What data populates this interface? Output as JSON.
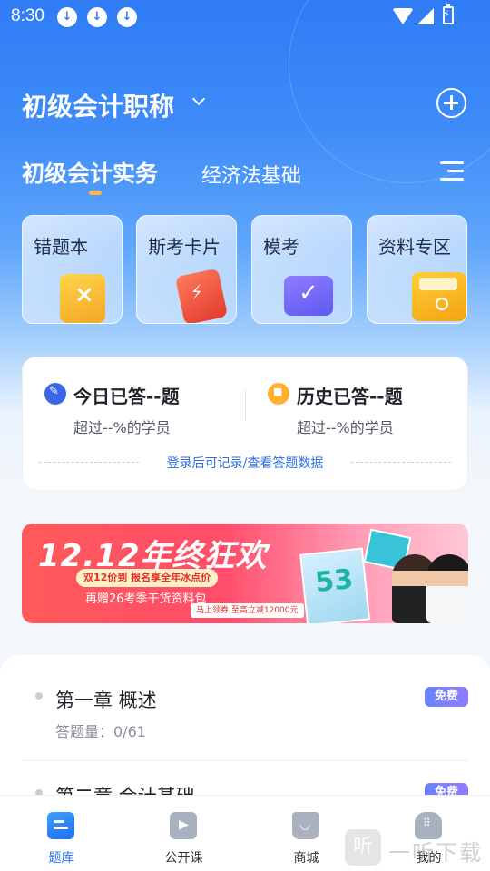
{
  "status_bar": {
    "time": "8:30",
    "download_icons": [
      "download-icon",
      "download-icon",
      "download-icon"
    ]
  },
  "header": {
    "exam_title": "初级会计职称",
    "add_icon": "plus-circle-icon"
  },
  "subject_tabs": [
    {
      "label": "初级会计实务",
      "active": true
    },
    {
      "label": "经济法基础",
      "active": false
    }
  ],
  "tools": [
    {
      "label": "错题本",
      "icon": "wrong-book-icon"
    },
    {
      "label": "斯考卡片",
      "icon": "flash-card-icon"
    },
    {
      "label": "模考",
      "icon": "mock-exam-icon"
    },
    {
      "label": "资料专区",
      "icon": "folder-icon"
    }
  ],
  "stats": {
    "today_title": "今日已答--题",
    "today_sub": "超过--%的学员",
    "history_title": "历史已答--题",
    "history_sub": "超过--%的学员",
    "login_hint": "登录后可记录/查看答题数据"
  },
  "banner": {
    "title": "12.12年终狂欢",
    "pill": "双12价到 报名享全年冰点价",
    "line": "再赠26考季干货资料包",
    "cta": "马上领券 至高立减12000元"
  },
  "chapters": [
    {
      "title": "第一章 概述",
      "count": "答题量：0/61",
      "badge": "免费"
    },
    {
      "title": "第二章 会计基础",
      "badge": "免费"
    }
  ],
  "bottom_nav": [
    {
      "label": "题库",
      "icon": "question-bank-icon",
      "active": true
    },
    {
      "label": "公开课",
      "icon": "video-play-icon",
      "active": false
    },
    {
      "label": "商城",
      "icon": "shopping-bag-icon",
      "active": false
    },
    {
      "label": "我的",
      "icon": "profile-icon",
      "active": false
    }
  ],
  "watermark": {
    "glyph": "听",
    "text": "一听下载"
  },
  "colors": {
    "primary": "#2f7cf6",
    "accent": "#ffb54a",
    "badge": "#7a7fff"
  }
}
